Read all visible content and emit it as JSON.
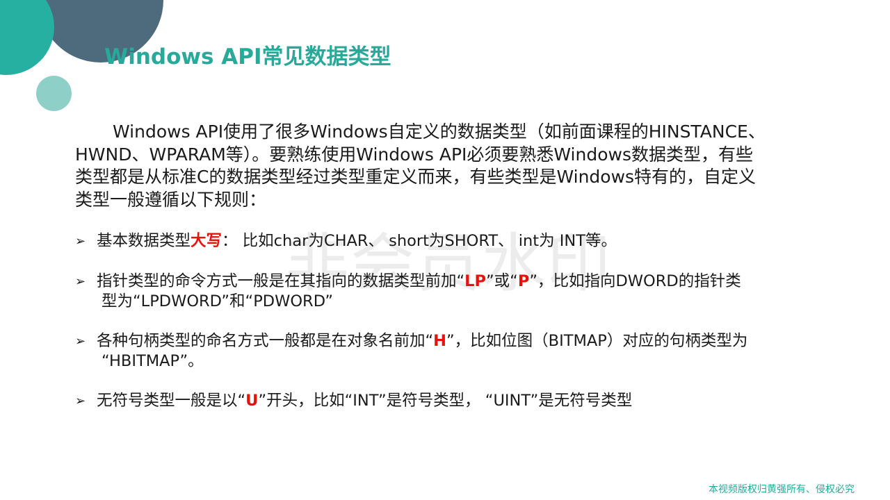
{
  "slide": {
    "title": "Windows API常见数据类型",
    "watermark": "非会员水印",
    "intro": {
      "line1": "Windows API使用了很多Windows自定义的数据类型（如前面课程的HINSTANCE、",
      "line2": "HWND、WPARAM等）。要熟练使用Windows API必须要熟悉Windows数据类型，有些",
      "line3": "类型都是从标准C的数据类型经过类型重定义而来，有些类型是Windows特有的，自定义",
      "line4": "类型一般遵循以下规则："
    },
    "bullet_marker": "➢",
    "bullets": [
      {
        "before": "基本数据类型",
        "highlight": "大写",
        "after": "： 比如char为CHAR、 short为SHORT、 int为 INT等。"
      },
      {
        "before": "指针类型的命令方式一般是在其指向的数据类型前加“",
        "highlight": "LP",
        "middle": "”或“",
        "highlight2": "P",
        "after": "”，比如指向DWORD的指针类",
        "continuation": "型为“LPDWORD”和“PDWORD”"
      },
      {
        "before": "各种句柄类型的命名方式一般都是在对象名前加“",
        "highlight": "H",
        "after": "”，比如位图（BITMAP）对应的句柄类型为",
        "continuation": "“HBITMAP”。"
      },
      {
        "before": "无符号类型一般是以“",
        "highlight": "U",
        "after": "”开头，比如“INT”是符号类型， “UINT”是无符号类型"
      }
    ],
    "footer": "本视频版权归黄强所有、侵权必究"
  },
  "colors": {
    "title": "#28a99a",
    "highlight": "#e8120c",
    "deco_dark": "#4d6b7c",
    "deco_teal": "#26b0a1",
    "deco_light": "#8ed0c8"
  }
}
